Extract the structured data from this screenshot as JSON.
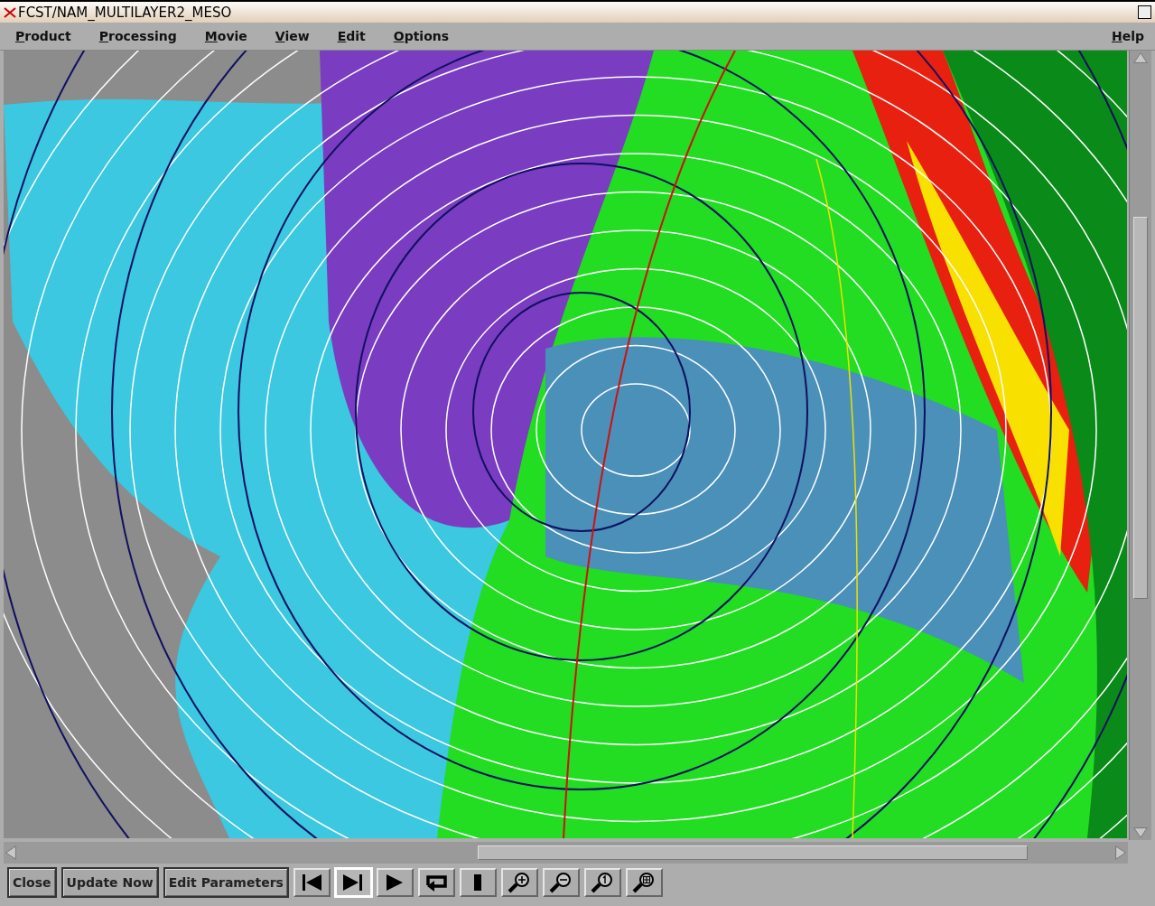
{
  "window": {
    "title": "FCST/NAM_MULTILAYER2_MESO"
  },
  "menu": [
    {
      "label": "Product"
    },
    {
      "label": "Processing"
    },
    {
      "label": "Movie"
    },
    {
      "label": "View"
    },
    {
      "label": "Edit"
    },
    {
      "label": "Options"
    }
  ],
  "help_menu": {
    "label": "Help"
  },
  "buttons": [
    "Close",
    "Update Now",
    "Edit Parameters"
  ],
  "tools": [
    {
      "kind": "first",
      "selected": false
    },
    {
      "kind": "last",
      "selected": true
    },
    {
      "kind": "play",
      "selected": false
    },
    {
      "kind": "loop",
      "selected": false
    },
    {
      "kind": "stop",
      "selected": false
    },
    {
      "kind": "zoom-in",
      "selected": false
    },
    {
      "kind": "zoom-out",
      "selected": false
    },
    {
      "kind": "zoom-one",
      "selected": false
    },
    {
      "kind": "zoom-fit",
      "selected": false
    }
  ]
}
